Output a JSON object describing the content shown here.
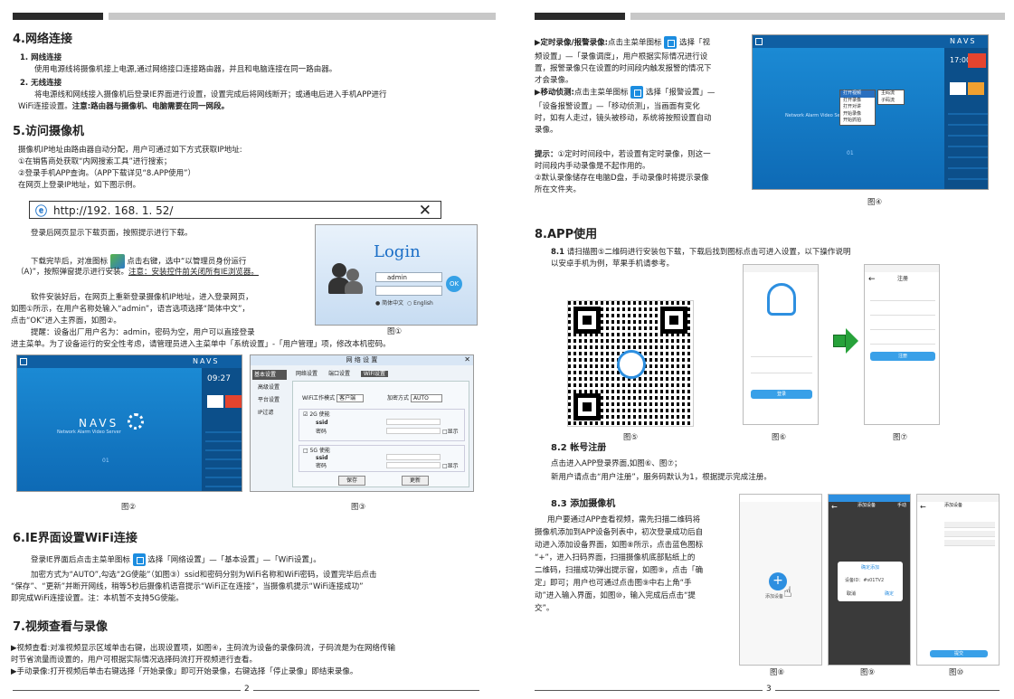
{
  "left": {
    "s4_title": "4.网络连接",
    "s4_1_title": "1. 网线连接",
    "s4_1_body": "使用电源线将摄像机接上电源,通过网络接口连接路由器，并且和电脑连接在同一路由器。",
    "s4_2_title": "2. 无线连接",
    "s4_2_body_a": "将电源线和网线接入摄像机后登录IE界面进行设置，设置完成后将网线断开；或通电后进入手机APP进行",
    "s4_2_body_b": "WiFi连接设置。",
    "s4_2_note": "注意:路由器与摄像机、电脑需要在同一网段。",
    "s5_title": "5.访问摄像机",
    "s5_l1": "摄像机IP地址由路由器自动分配，用户可通过如下方式获取IP地址:",
    "s5_l2": "①在销售商处获取“内网搜索工具”进行搜索；",
    "s5_l3": "②登录手机APP查询。（APP下载详见“8.APP使用”）",
    "s5_l4": "在网页上登录IP地址，如下图示例。",
    "url": "http://192. 168. 1. 52/",
    "p_a1": "登录后网页显示下载页面，按照提示进行下载。",
    "p_b1": "下载完毕后，对准图标",
    "p_b2": "点击右键，选中“以管理员身份运行",
    "p_b3": "（A)”，按照弹窗提示进行安装。",
    "p_b4": "注意：安装控件前关闭所有IE浏览器。",
    "p_c1": "软件安装好后，在网页上重新登录摄像机IP地址，进入登录网页，",
    "p_c2": "如图①所示，在用户名称处输入“admin”，语言选项选择“简体中文”，",
    "p_c3": "点击“OK”进入主界面，如图②。",
    "p_d1": "提醒：设备出厂用户名为：admin，密码为空，用户可以直接登录",
    "p_d2": "进主菜单。为了设备运行的安全性考虑，请管理员进入主菜单中「系统设置」-「用户管理」项，修改本机密码。",
    "login_title": "Login",
    "login_user": "admin",
    "login_ok": "OK",
    "login_lang1": "简体中文",
    "login_lang2": "English",
    "fig1": "图①",
    "fig2": "图②",
    "fig3": "图③",
    "navs_logo": "NAVS",
    "navs_sub": "Network Alarm Video Server",
    "navs_time": "09:27",
    "navs_ch": "01",
    "wifi_dlg_title": "网 络 设 置",
    "wifi_menu": [
      "基本设置",
      "高级设置",
      "平台设置",
      "IP过滤"
    ],
    "wifi_tabs": [
      "网络设置",
      "端口设置",
      "WiFi设置"
    ],
    "wifi_mode_label": "WiFi工作模式",
    "wifi_mode_value": "客户端",
    "wifi_enc_label": "加密方式",
    "wifi_enc_value": "AUTO",
    "wifi_2g": "2G 使能",
    "wifi_5g": "5G 使能",
    "wifi_ssid": "ssid",
    "wifi_pwd": "密码",
    "wifi_show": "显示",
    "wifi_save": "保存",
    "wifi_update": "更新",
    "s6_title": "6.IE界面设置WiFi连接",
    "s6_l1a": "登录IE界面后点击主菜单图标",
    "s6_l1b": "选择「网络设置」—「基本设置」—「WiFi设置」。",
    "s6_l2": "加密方式为“AUTO”,勾选“2G使能”（如图③）ssid和密码分别为WiFi名称和WiFi密码，设置完毕后点击",
    "s6_l3": "“保存”、“更新”并断开网线，稍等5秒后摄像机语音提示“WiFi正在连接”，当摄像机提示“WiFi连接成功”",
    "s6_l4": "即完成WiFi连接设置。注：本机暂不支持5G使能。",
    "s7_title": "7.视频查看与录像",
    "s7_l1": "▶视频查看:对准视频显示区域单击右键，出现设置项，如图④，主码流为设备的录像码流，子码流是为在网络传输",
    "s7_l2": "时节省流量而设置的，用户可根据实际情况选择码流打开视频进行查看。",
    "s7_l3": "▶手动录像:打开视频后单击右键选择「开始录像」即可开始录像，右键选择「停止录像」即结束录像。",
    "page_num": "2"
  },
  "right": {
    "r1_l1a": "▶定时录像/报警录像:",
    "r1_l1b": "点击主菜单图标",
    "r1_l1c": "选择「视",
    "r1_l2": "频设置」—「录像调度」，用户根据实际情况进行设",
    "r1_l3": "置，报警录像只在设置的时间段内触发报警的情况下",
    "r1_l4": "才会录像。",
    "r2_l1a": "▶移动侦测:",
    "r2_l1b": "点击主菜单图标",
    "r2_l1c": "选择「报警设置」—",
    "r2_l2": "「设备报警设置」—「移动侦测」，当画面有变化",
    "r2_l3": "时，如有人走过，镜头被移动，系统将按照设置自动",
    "r2_l4": "录像。",
    "tip_l1a": "提示：",
    "tip_l1b": "①定时时间段中，若设置有定时录像，则这一",
    "tip_l2": "时间段内手动录像是不起作用的。",
    "tip_l3": "②默认录像储存在电脑D盘，手动录像时将提示录像",
    "tip_l4": "所在文件夹。",
    "navs_logo": "NAVS",
    "navs_sub": "Network Alarm Video Server",
    "navs_time": "17:00",
    "navs_ch": "01",
    "ctx_menu": [
      "打开视频",
      "打开录像",
      "打开对讲",
      "开始录像",
      "开始抓拍"
    ],
    "ctx_sub": [
      "主码流",
      "子码流"
    ],
    "fig4": "图④",
    "s8_title": "8.APP使用",
    "s81_l1a": "8.1",
    "s81_l1b": "请扫描图⑤二维码进行安装包下载，下载后找到图标点击可进入设置，以下操作说明",
    "s81_l2": "以安卓手机为例，苹果手机请参考。",
    "fig5": "图⑤",
    "fig6": "图⑥",
    "fig7": "图⑦",
    "s82_title": "8.2 帐号注册",
    "s82_l1": "点击进入APP登录界面,如图⑥、图⑦；",
    "s82_l2": "新用户请点击“用户注册”，服务码默认为1，根据提示完成注册。",
    "s83_title": "8.3 添加摄像机",
    "s83_l1": "用户要通过APP查看视频，需先扫描二维码将",
    "s83_l2": "摄像机添加到APP设备列表中，初次登录成功后自",
    "s83_l3": "动进入添加设备界面，如图⑧所示，点击蓝色图标",
    "s83_l4": "“+”，进入扫码界面，扫描摄像机底部贴纸上的",
    "s83_l5": "二维码，扫描成功弹出提示窗，如图⑨，点击「确",
    "s83_l6": "定」即可；用户也可通过点击图⑨中右上角“手",
    "s83_l7": "动”进入输入界面，如图⑩，输入完成后点击“提",
    "s83_l8": "交”。",
    "app_login_btn": "登录",
    "app_register_title": "注册",
    "app_register_btn": "注册",
    "app_add_device": "添加设备",
    "app_scan_title": "添加设备",
    "app_manual": "手动",
    "app_dialog_title": "确定添加",
    "app_dialog_id": "设备ID：#s01TV2",
    "app_cancel": "取消",
    "app_ok": "确定",
    "app_submit": "提交",
    "app_input_title": "添加设备",
    "fig8": "图⑧",
    "fig9": "图⑨",
    "fig10": "图⑩",
    "page_num": "3"
  }
}
